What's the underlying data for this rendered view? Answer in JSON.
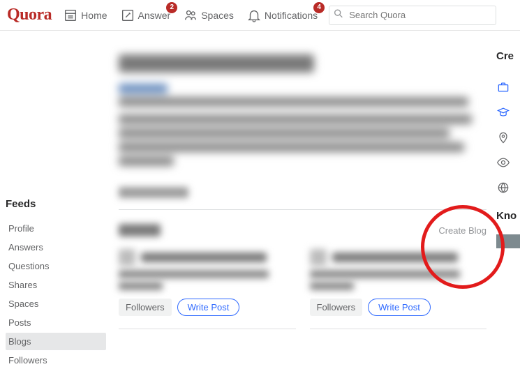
{
  "header": {
    "logo": "Quora",
    "nav": {
      "home": "Home",
      "answer": "Answer",
      "answer_badge": "2",
      "spaces": "Spaces",
      "notifications": "Notifications",
      "notifications_badge": "4"
    },
    "search_placeholder": "Search Quora"
  },
  "sidebar": {
    "title": "Feeds",
    "items": [
      {
        "label": "Profile"
      },
      {
        "label": "Answers"
      },
      {
        "label": "Questions"
      },
      {
        "label": "Shares"
      },
      {
        "label": "Spaces"
      },
      {
        "label": "Posts"
      },
      {
        "label": "Blogs"
      },
      {
        "label": "Followers"
      }
    ],
    "selected_index": 6
  },
  "section": {
    "create_blog": "Create Blog"
  },
  "blogs": [
    {
      "followers_label": "Followers",
      "write_post_label": "Write Post"
    },
    {
      "followers_label": "Followers",
      "write_post_label": "Write Post"
    }
  ],
  "rightrail": {
    "credentials_label": "Cre",
    "knows_label": "Kno"
  }
}
